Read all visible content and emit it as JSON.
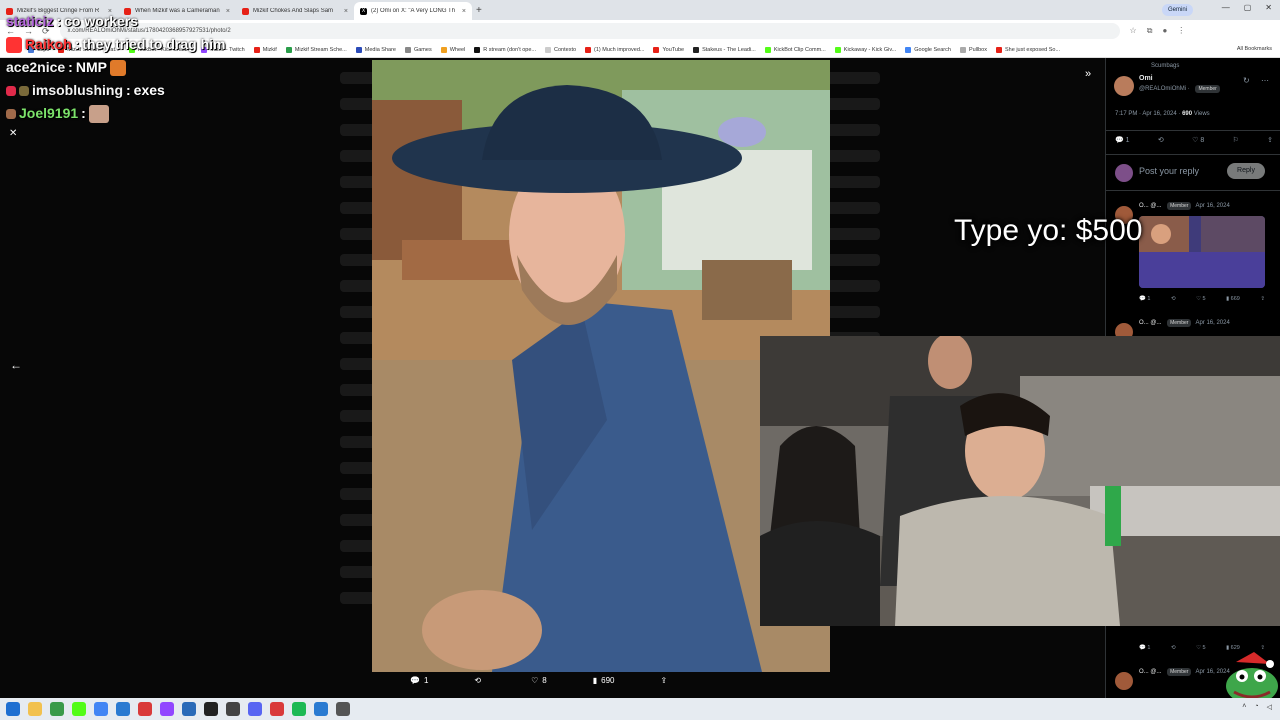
{
  "browser": {
    "tabs": [
      {
        "label": "Mizkif's Biggest Cringe From R",
        "favicon": "youtube-icon",
        "active": false
      },
      {
        "label": "When Mizkif was a Cameraman",
        "favicon": "youtube-icon",
        "active": false
      },
      {
        "label": "Mizkif Chokes And Slaps Sam",
        "favicon": "youtube-icon",
        "active": false
      },
      {
        "label": "(2) Omi on X: \"A Very LONG Th",
        "favicon": "x-icon",
        "active": true
      }
    ],
    "new_tab": "+",
    "gemini_label": "Gemini",
    "url": "x.com/REALOmiOhMi/status/1780420368957927531/photo/2",
    "bookmarks": [
      "Clips",
      "Mizkif Stream - Wat...",
      "KickBot - Kick Chatb...",
      "Mizkif - Twitch",
      "Mizkif",
      "Mizkif Stream Sche...",
      "Media Share",
      "Games",
      "Wheel",
      "R stream (don't ope...",
      "Contexto",
      "(1) Much improved...",
      "YouTube",
      "Stakeus - The Leadi...",
      "KickBot Clip Comm...",
      "Kickaway - Kick Giv...",
      "Google Search",
      "Pullbox",
      "She just exposed So..."
    ],
    "all_bookmarks": "All Bookmarks"
  },
  "chat": [
    {
      "user": "staticiz",
      "message": "co workers",
      "color": "#b865e0"
    },
    {
      "user": "Raikoh",
      "message": "they tried to drag him",
      "color": "#ff3333"
    },
    {
      "user": "ace2nice",
      "message": "NMP",
      "color": "#f2f2f2"
    },
    {
      "user": "imsoblushing",
      "message": "exes",
      "color": "#f2f2f2"
    },
    {
      "user": "Joel9191",
      "message": "",
      "color": "#7ce26a"
    }
  ],
  "viewer": {
    "actions": [
      {
        "icon": "reply-icon",
        "count": "1"
      },
      {
        "icon": "repost-icon",
        "count": ""
      },
      {
        "icon": "heart-icon",
        "count": "8"
      },
      {
        "icon": "views-icon",
        "count": "690"
      },
      {
        "icon": "share-icon",
        "count": ""
      }
    ]
  },
  "panel": {
    "community": "Scumbags",
    "name": "Omi",
    "handle": "@REALOmiOhMi",
    "badge": "Member",
    "time": "7:17 PM · Apr 16, 2024",
    "views_count": "690",
    "views_label": "Views",
    "stats": [
      {
        "icon": "reply-icon",
        "count": "1"
      },
      {
        "icon": "repost-icon",
        "count": ""
      },
      {
        "icon": "heart-icon",
        "count": "8"
      },
      {
        "icon": "bookmark-icon",
        "count": ""
      },
      {
        "icon": "share-icon",
        "count": ""
      }
    ],
    "reply_placeholder": "Post your reply",
    "reply_button": "Reply",
    "replies": [
      {
        "name": "O...",
        "handle": "@...",
        "badge": "Member",
        "date": "Apr 16, 2024",
        "stats": [
          "1",
          "",
          "5",
          "669",
          ""
        ]
      },
      {
        "name": "O...",
        "handle": "@...",
        "badge": "Member",
        "date": "Apr 16, 2024",
        "stats": [
          "1",
          "",
          "5",
          "629",
          ""
        ]
      },
      {
        "name": "O...",
        "handle": "@...",
        "badge": "Member",
        "date": "Apr 16, 2024",
        "stats": []
      }
    ]
  },
  "donation": {
    "text": "Type yo: $500"
  },
  "colors": {
    "accent": "#1d9bf0",
    "background": "#000000"
  }
}
